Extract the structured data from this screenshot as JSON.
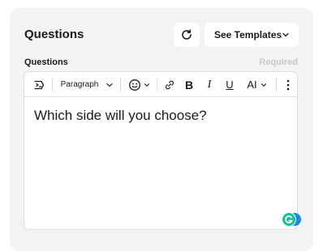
{
  "header": {
    "title": "Questions",
    "refresh_icon": "refresh-icon",
    "templates_label": "See Templates"
  },
  "field": {
    "label": "Questions",
    "required_label": "Required"
  },
  "toolbar": {
    "items": [
      "ai-rewrite-icon",
      "paragraph-style",
      "emoji-icon",
      "link-icon",
      "bold",
      "italic",
      "underline",
      "text-size",
      "more-options-icon"
    ],
    "paragraph_label": "Paragraph",
    "bold_label": "B",
    "italic_label": "I",
    "underline_label": "U",
    "text_size_label": "AI"
  },
  "editor": {
    "content": "Which side will you choose?"
  },
  "colors": {
    "card_bg": "#f3f3f3",
    "required_text": "#c8c8c8",
    "grammarly_green": "#15c39a",
    "grammarly_blue": "#1e88e5"
  }
}
